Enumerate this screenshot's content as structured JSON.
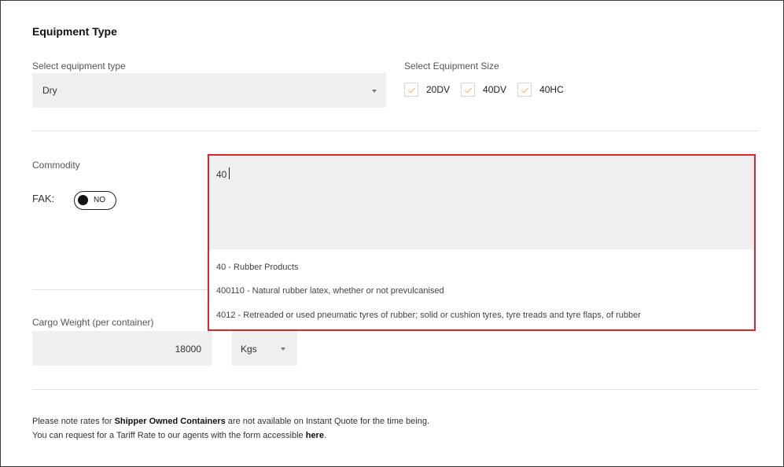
{
  "equipment": {
    "title": "Equipment Type",
    "type_label": "Select equipment type",
    "type_value": "Dry",
    "size_label": "Select Equipment Size",
    "sizes": [
      {
        "label": "20DV",
        "checked": true
      },
      {
        "label": "40DV",
        "checked": true
      },
      {
        "label": "40HC",
        "checked": true
      }
    ]
  },
  "commodity": {
    "label": "Commodity",
    "fak_label": "FAK:",
    "fak_toggle": "NO",
    "input_value": "40",
    "options": [
      "40 - Rubber Products",
      "400110 - Natural rubber latex, whether or not prevulcanised",
      "4012 - Retreaded or used pneumatic tyres of rubber; solid or cushion tyres, tyre treads and tyre flaps, of rubber"
    ]
  },
  "cargo": {
    "weight_label": "Cargo Weight (per container)",
    "weight_value": "18000",
    "unit_value": "Kgs"
  },
  "note": {
    "line1_pre": "Please note rates for ",
    "line1_bold": "Shipper Owned Containers",
    "line1_post": " are not available on Instant Quote for the time being.",
    "line2_pre": "You can request for a Tariff Rate to our agents with the form accessible ",
    "line2_link": "here",
    "line2_post": "."
  },
  "colors": {
    "highlight_border": "#d9242c",
    "checkmark": "#f0b85a",
    "field_bg": "#efefef"
  }
}
